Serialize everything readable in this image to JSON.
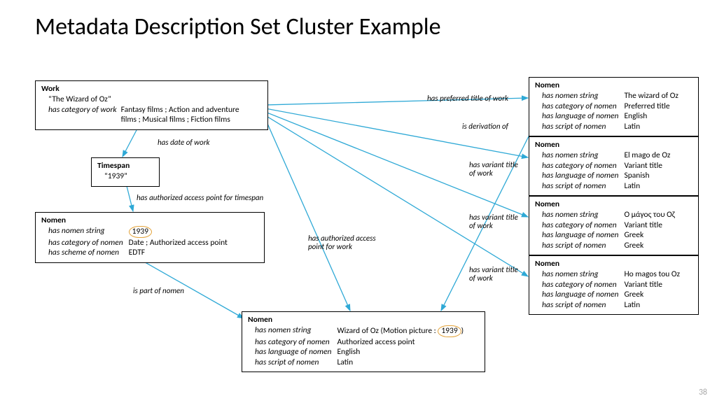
{
  "title": "Metadata Description Set Cluster Example",
  "slide_number": "38",
  "work": {
    "label": "Work",
    "title": "“The Wizard of Oz”",
    "category_key": "has category of work",
    "category_val": "Fantasy films ; Action and adventure films ; Musical films ; Fiction films"
  },
  "timespan": {
    "label": "Timespan",
    "value": "“1939”"
  },
  "nomen_date": {
    "label": "Nomen",
    "rows": [
      {
        "k": "has nomen string",
        "v": "1939",
        "circled": true
      },
      {
        "k": "has category of nomen",
        "v": "Date ; Authorized access point"
      },
      {
        "k": "has scheme of nomen",
        "v": "EDTF"
      }
    ]
  },
  "nomen_access": {
    "label": "Nomen",
    "rows": [
      {
        "k": "has nomen string",
        "v_pre": "Wizard of Oz (Motion picture : ",
        "v_circ": "1939",
        "v_post": ")"
      },
      {
        "k": "has category of nomen",
        "v": "Authorized access point"
      },
      {
        "k": "has language of nomen",
        "v": "English"
      },
      {
        "k": "has script of nomen",
        "v": "Latin"
      }
    ]
  },
  "nomens_right": [
    {
      "label": "Nomen",
      "rows": [
        {
          "k": "has nomen string",
          "v": "The wizard of Oz"
        },
        {
          "k": "has category of nomen",
          "v": "Preferred title"
        },
        {
          "k": "has language of nomen",
          "v": "English"
        },
        {
          "k": "has script of nomen",
          "v": "Latin"
        }
      ]
    },
    {
      "label": "Nomen",
      "rows": [
        {
          "k": "has nomen string",
          "v": "El mago de Oz"
        },
        {
          "k": "has category of nomen",
          "v": "Variant title"
        },
        {
          "k": "has language of nomen",
          "v": "Spanish"
        },
        {
          "k": "has script of nomen",
          "v": "Latin"
        }
      ]
    },
    {
      "label": "Nomen",
      "rows": [
        {
          "k": "has nomen string",
          "v": "Ο μάγος του Οζ"
        },
        {
          "k": "has category of nomen",
          "v": "Variant title"
        },
        {
          "k": "has language of nomen",
          "v": "Greek"
        },
        {
          "k": "has script of nomen",
          "v": "Greek"
        }
      ]
    },
    {
      "label": "Nomen",
      "rows": [
        {
          "k": "has nomen string",
          "v": "Ho magos tou Oz"
        },
        {
          "k": "has category of nomen",
          "v": "Variant title"
        },
        {
          "k": "has language of nomen",
          "v": "Greek"
        },
        {
          "k": "has script of nomen",
          "v": "Latin"
        }
      ]
    }
  ],
  "edges": {
    "has_date_of_work": "has date of work",
    "has_authorized_access_point_for_timespan": "has authorized access point for timespan",
    "is_part_of_nomen": "is part of nomen",
    "has_authorized_access_point_for_work": "has authorized access point for work",
    "has_preferred_title_of_work": "has preferred title of work",
    "is_derivation_of": "is derivation of",
    "has_variant_title_of_work_1": "has variant title of work",
    "has_variant_title_of_work_2": "has variant title of work",
    "has_variant_title_of_work_3": "has variant title of work"
  }
}
